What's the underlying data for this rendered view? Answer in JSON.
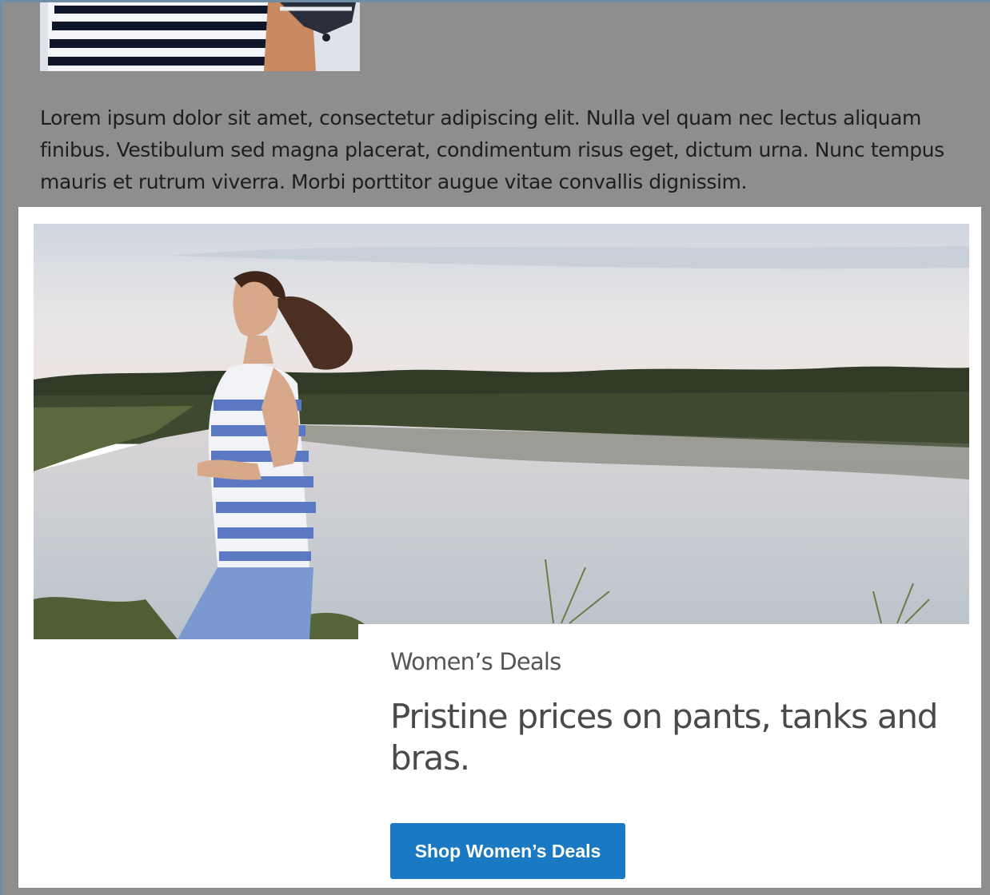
{
  "intro": {
    "paragraph": "Lorem ipsum dolor sit amet, consectetur adipiscing elit. Nulla vel quam nec lectus aliquam finibus. Vestibulum sed magna placerat, condimentum risus eget, dictum urna. Nunc tempus mauris et rutrum viverra. Morbi porttitor augue vitae convallis dignissim."
  },
  "promo": {
    "eyebrow": "Women’s Deals",
    "headline": "Pristine prices on pants, tanks and bras.",
    "cta_label": "Shop Women’s Deals"
  },
  "colors": {
    "page_overlay": "#8e8e8e",
    "card_background": "#ffffff",
    "cta_background": "#1979c3",
    "cta_text": "#ffffff"
  },
  "images": {
    "top_image": "striped-shirt-crop",
    "hero_image": "woman-running-by-lake"
  }
}
